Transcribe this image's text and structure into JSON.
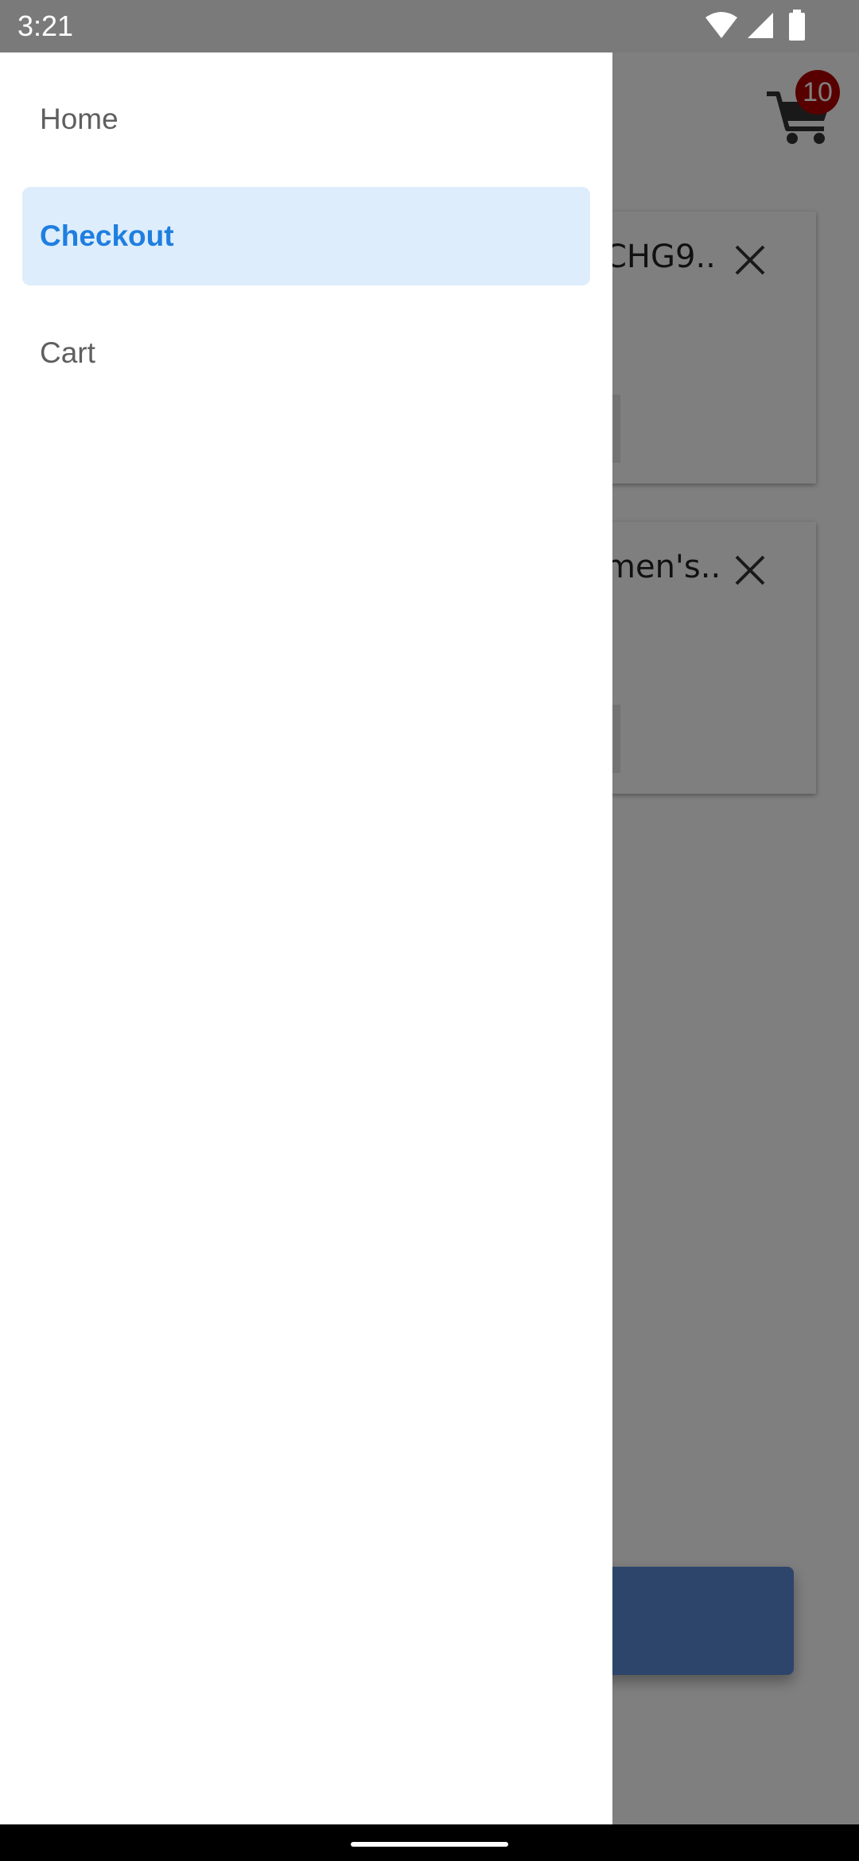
{
  "status_bar": {
    "time": "3:21",
    "icons": [
      "wifi-icon",
      "cellular-signal-icon",
      "battery-icon"
    ]
  },
  "drawer": {
    "items": [
      {
        "label": "Home",
        "active": false
      },
      {
        "label": "Checkout",
        "active": true
      },
      {
        "label": "Cart",
        "active": false
      }
    ]
  },
  "background": {
    "cart_badge_count": "10",
    "cart_items": [
      {
        "title_visible": "CHG9.."
      },
      {
        "title_visible": "men's.."
      }
    ]
  },
  "colors": {
    "active_item_bg": "#deedfc",
    "active_item_text": "#1f7fe0",
    "badge": "#b00000",
    "scrim": "rgba(0,0,0,0.5)"
  }
}
